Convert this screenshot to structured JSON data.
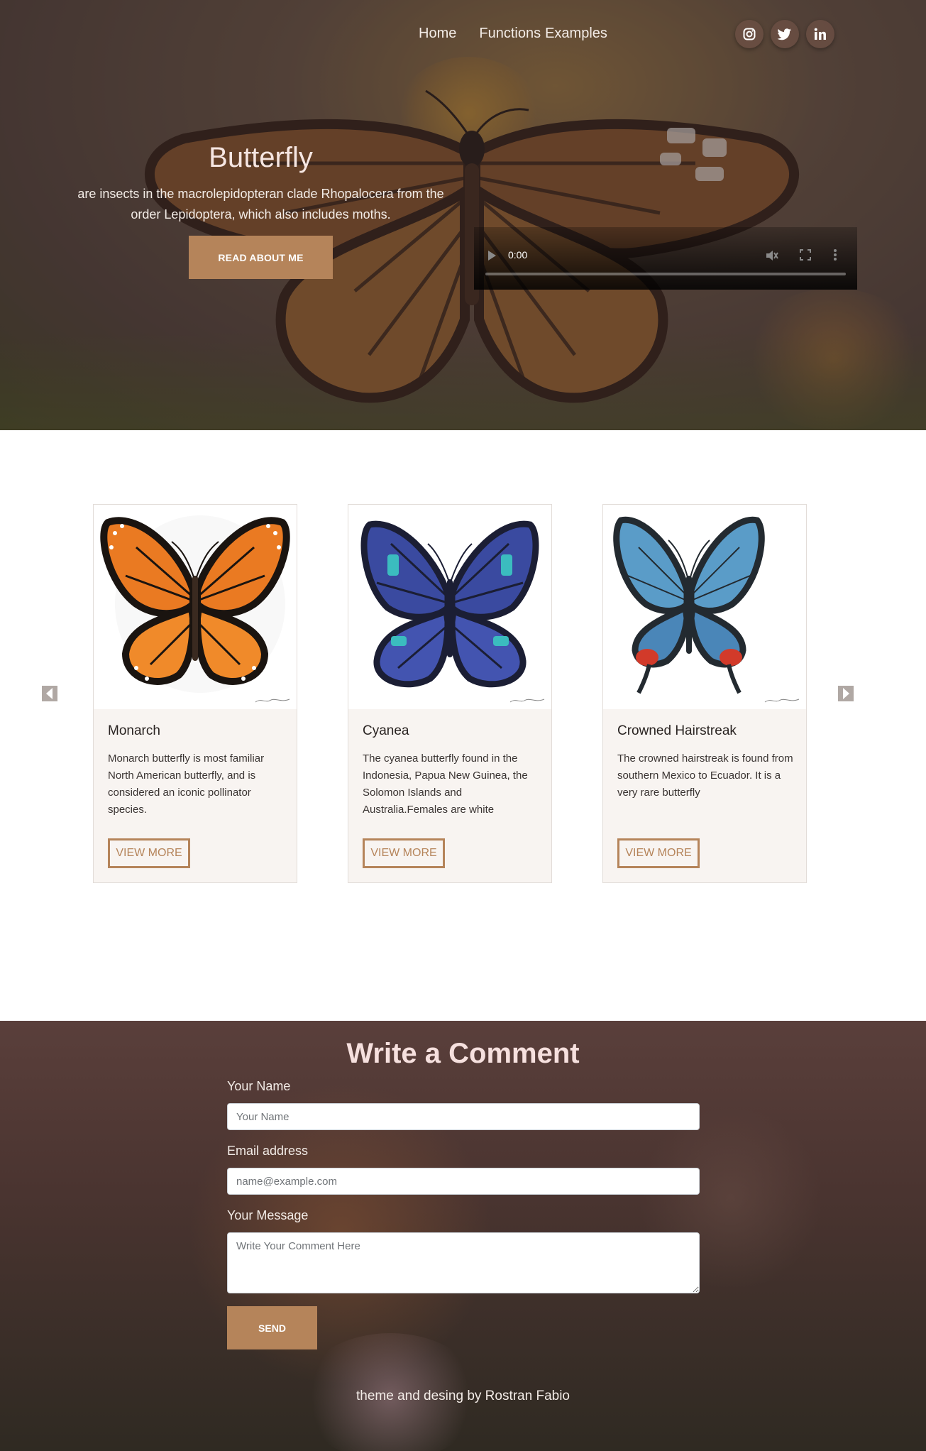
{
  "nav": {
    "home": "Home",
    "functions": "Functions",
    "examples": "Examples"
  },
  "social": [
    "instagram-icon",
    "twitter-icon",
    "linkedin-icon"
  ],
  "hero": {
    "title": "Butterfly",
    "description": "are insects in the macrolepidopteran clade Rhopalocera from the order Lepidoptera, which also includes moths.",
    "button": "READ ABOUT ME"
  },
  "video": {
    "time": "0:00",
    "progress": 0
  },
  "cards": [
    {
      "name": "Monarch",
      "desc": "Monarch butterfly is most familiar North American butterfly, and is considered an iconic pollinator species.",
      "button": "VIEW MORE"
    },
    {
      "name": "Cyanea",
      "desc": "The cyanea butterfly found in the Indonesia, Papua New Guinea, the Solomon Islands and Australia.Females are white",
      "button": "VIEW MORE"
    },
    {
      "name": "Crowned Hairstreak",
      "desc": "The crowned hairstreak is found from southern Mexico to Ecuador. It is a very rare butterfly",
      "button": "VIEW MORE"
    }
  ],
  "comment": {
    "title": "Write a Comment",
    "name_label": "Your Name",
    "name_placeholder": "Your Name",
    "email_label": "Email address",
    "email_placeholder": "name@example.com",
    "message_label": "Your Message",
    "message_placeholder": "Write Your Comment Here",
    "send": "SEND"
  },
  "footer": "theme and desing by Rostran Fabio",
  "colors": {
    "accent": "#b5845a",
    "card_bg": "#f8f4f1",
    "hero_text": "#f3ece7"
  }
}
